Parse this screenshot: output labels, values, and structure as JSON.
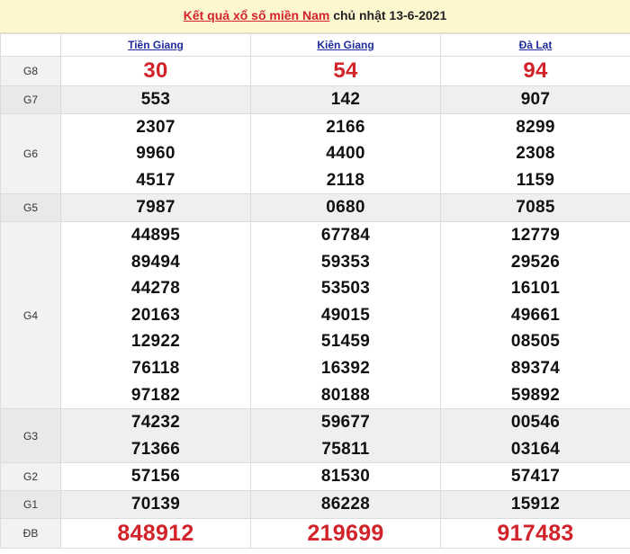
{
  "header": {
    "title": "Kết quả xổ số miền Nam",
    "date": "chủ nhật 13-6-2021"
  },
  "provinces": [
    "Tiền Giang",
    "Kiên Giang",
    "Đà Lạt"
  ],
  "rows": {
    "g8": {
      "label": "G8",
      "values": [
        [
          "30"
        ],
        [
          "54"
        ],
        [
          "94"
        ]
      ]
    },
    "g7": {
      "label": "G7",
      "values": [
        [
          "553"
        ],
        [
          "142"
        ],
        [
          "907"
        ]
      ]
    },
    "g6": {
      "label": "G6",
      "values": [
        [
          "2307",
          "9960",
          "4517"
        ],
        [
          "2166",
          "4400",
          "2118"
        ],
        [
          "8299",
          "2308",
          "1159"
        ]
      ]
    },
    "g5": {
      "label": "G5",
      "values": [
        [
          "7987"
        ],
        [
          "0680"
        ],
        [
          "7085"
        ]
      ]
    },
    "g4": {
      "label": "G4",
      "values": [
        [
          "44895",
          "89494",
          "44278",
          "20163",
          "12922",
          "76118",
          "97182"
        ],
        [
          "67784",
          "59353",
          "53503",
          "49015",
          "51459",
          "16392",
          "80188"
        ],
        [
          "12779",
          "29526",
          "16101",
          "49661",
          "08505",
          "89374",
          "59892"
        ]
      ]
    },
    "g3": {
      "label": "G3",
      "values": [
        [
          "74232",
          "71366"
        ],
        [
          "59677",
          "75811"
        ],
        [
          "00546",
          "03164"
        ]
      ]
    },
    "g2": {
      "label": "G2",
      "values": [
        [
          "57156"
        ],
        [
          "81530"
        ],
        [
          "57417"
        ]
      ]
    },
    "g1": {
      "label": "G1",
      "values": [
        [
          "70139"
        ],
        [
          "86228"
        ],
        [
          "15912"
        ]
      ]
    },
    "db": {
      "label": "ĐB",
      "values": [
        [
          "848912"
        ],
        [
          "219699"
        ],
        [
          "917483"
        ]
      ]
    }
  },
  "colors": {
    "accent_red": "#d2232a",
    "link_blue": "#1f2c9c",
    "header_bg": "#fdf7d0"
  }
}
